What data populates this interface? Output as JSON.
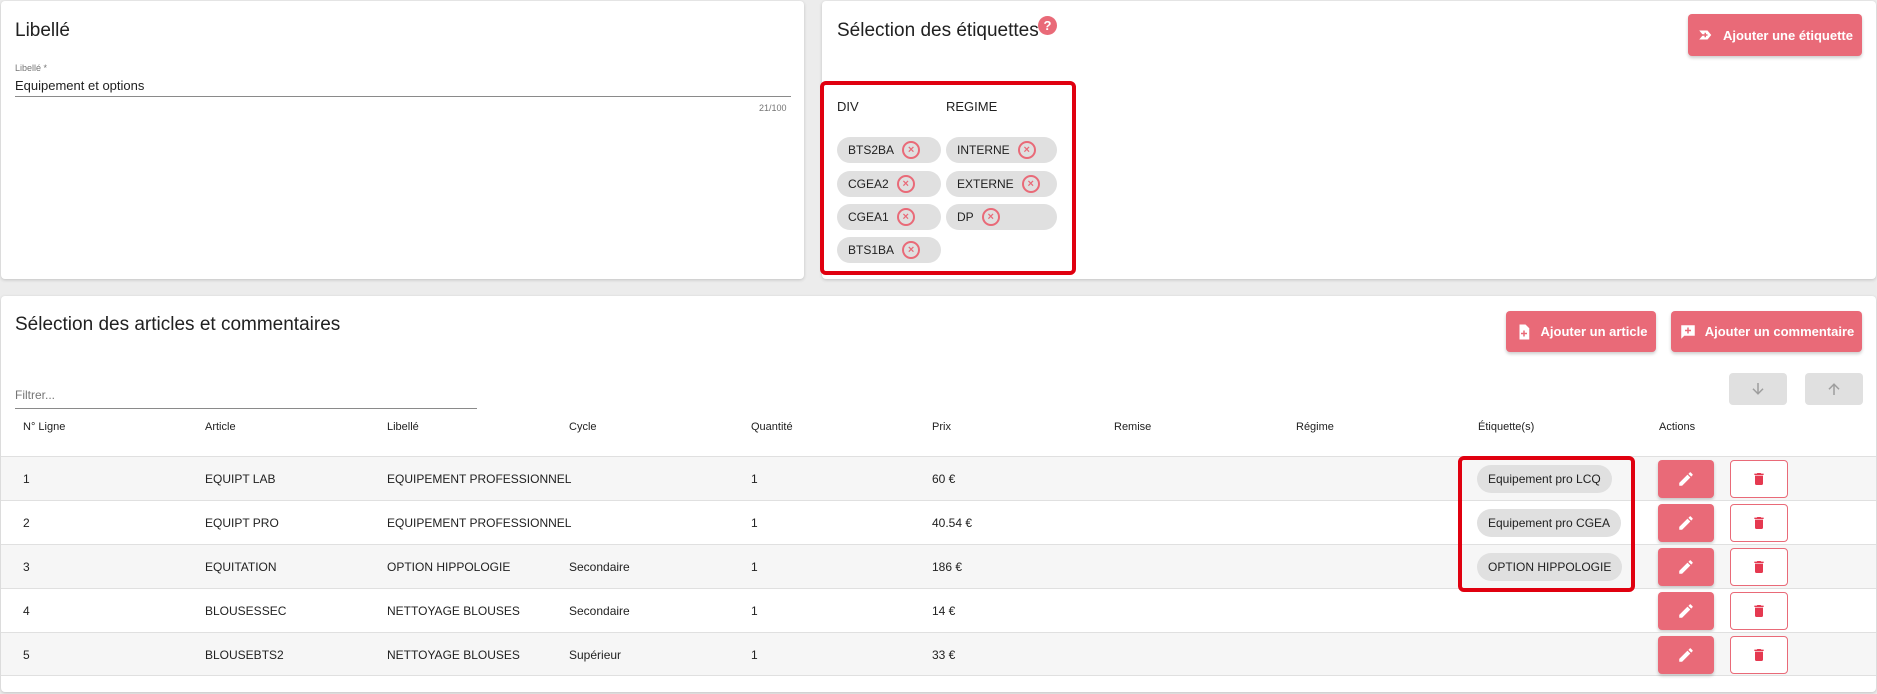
{
  "libelle_card": {
    "title": "Libellé",
    "field_label": "Libellé *",
    "field_value": "Equipement et options",
    "counter": "21/100"
  },
  "etiquettes_card": {
    "title": "Sélection des étiquettes",
    "help": "?",
    "add_button": "Ajouter une étiquette",
    "columns": [
      {
        "header": "DIV",
        "chips": [
          "BTS2BA",
          "CGEA2",
          "CGEA1",
          "BTS1BA"
        ]
      },
      {
        "header": "REGIME",
        "chips": [
          "INTERNE",
          "EXTERNE",
          "DP"
        ]
      }
    ],
    "remove_glyph": "×"
  },
  "articles_card": {
    "title": "Sélection des articles et commentaires",
    "add_article_button": "Ajouter un article",
    "add_comment_button": "Ajouter un commentaire",
    "filter_placeholder": "Filtrer...",
    "headers": [
      "N° Ligne",
      "Article",
      "Libellé",
      "Cycle",
      "Quantité",
      "Prix",
      "Remise",
      "Régime",
      "Étiquette(s)",
      "Actions"
    ],
    "rows": [
      {
        "num": "1",
        "article": "EQUIPT LAB",
        "libelle": "EQUIPEMENT PROFESSIONNEL",
        "cycle": "",
        "quantite": "1",
        "prix": "60 €",
        "remise": "",
        "regime": "",
        "etiquette": "Equipement pro LCQ"
      },
      {
        "num": "2",
        "article": "EQUIPT PRO",
        "libelle": "EQUIPEMENT PROFESSIONNEL",
        "cycle": "",
        "quantite": "1",
        "prix": "40.54 €",
        "remise": "",
        "regime": "",
        "etiquette": "Equipement pro CGEA"
      },
      {
        "num": "3",
        "article": "EQUITATION",
        "libelle": "OPTION HIPPOLOGIE",
        "cycle": "Secondaire",
        "quantite": "1",
        "prix": "186 €",
        "remise": "",
        "regime": "",
        "etiquette": "OPTION HIPPOLOGIE"
      },
      {
        "num": "4",
        "article": "BLOUSESSEC",
        "libelle": "NETTOYAGE BLOUSES",
        "cycle": "Secondaire",
        "quantite": "1",
        "prix": "14 €",
        "remise": "",
        "regime": "",
        "etiquette": ""
      },
      {
        "num": "5",
        "article": "BLOUSEBTS2",
        "libelle": "NETTOYAGE BLOUSES",
        "cycle": "Supérieur",
        "quantite": "1",
        "prix": "33 €",
        "remise": "",
        "regime": "",
        "etiquette": ""
      }
    ]
  },
  "colors": {
    "accent": "#e96a78",
    "highlight": "#e0000f",
    "chip_bg": "#e0e0e0"
  },
  "icons": [
    "help-icon",
    "add-label-icon",
    "remove-chip-icon",
    "add-article-icon",
    "add-comment-icon",
    "arrow-down-icon",
    "arrow-up-icon",
    "edit-pencil-icon",
    "trash-icon"
  ]
}
